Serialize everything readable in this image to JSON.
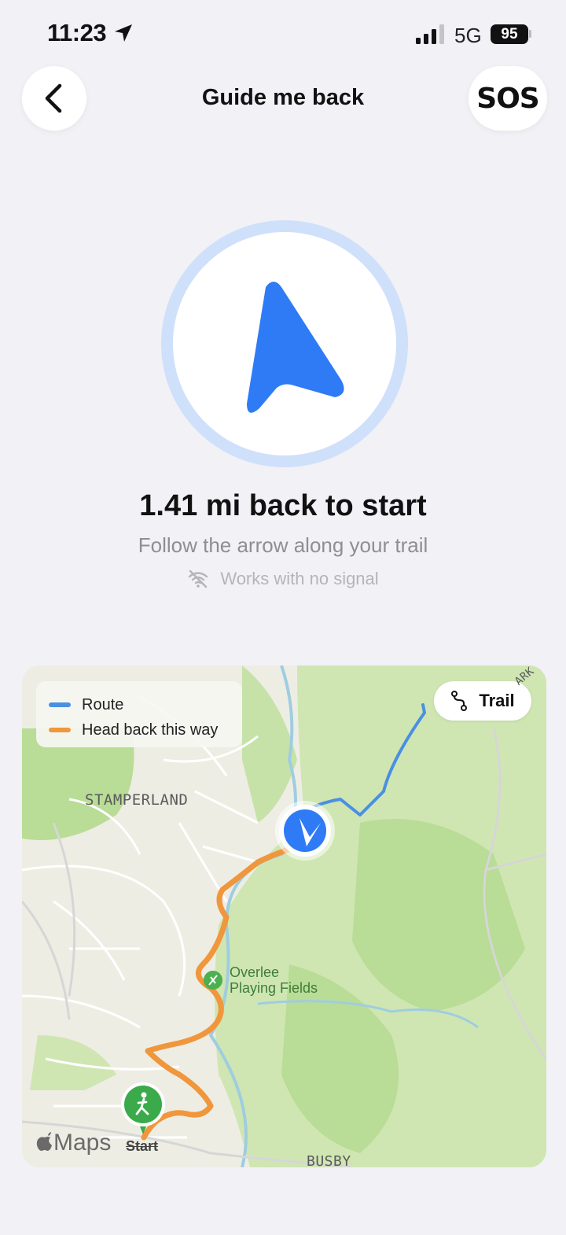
{
  "status_bar": {
    "time": "11:23",
    "network": "5G",
    "battery": "95"
  },
  "header": {
    "title": "Guide me back",
    "sos_label": "SOS"
  },
  "guide": {
    "distance_text": "1.41 mi back to start",
    "instruction": "Follow the arrow along your trail",
    "signal_note": "Works with no signal"
  },
  "map": {
    "legend": [
      {
        "label": "Route",
        "color": "#4a90e2"
      },
      {
        "label": "Head back this way",
        "color": "#f0963c"
      }
    ],
    "trail_button_label": "Trail",
    "place_labels": {
      "stamperland": "STAMPERLAND",
      "busby": "BUSBY",
      "edge": "ARK"
    },
    "poi": {
      "line1": "Overlee",
      "line2": "Playing Fields"
    },
    "start_label": "Start",
    "attribution": "Maps"
  },
  "colors": {
    "accent_blue": "#2f7bf5",
    "route_blue": "#4a90e2",
    "backtrack_orange": "#f0963c",
    "start_green": "#3aaa4a"
  },
  "icons": {
    "back": "chevron-left-icon",
    "location": "location-arrow-icon",
    "compass": "navigation-arrow-icon",
    "no_signal": "wifi-slash-icon",
    "trail": "trail-path-icon",
    "start": "walking-person-icon",
    "apple": "apple-logo-icon"
  }
}
